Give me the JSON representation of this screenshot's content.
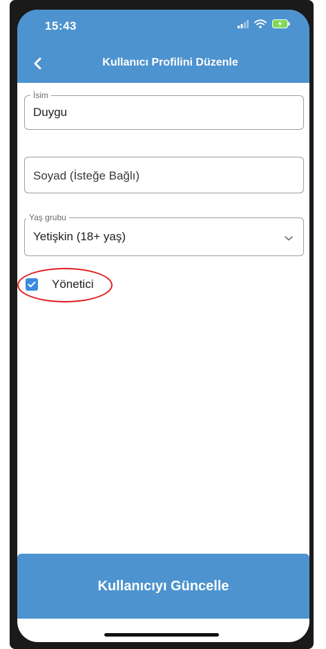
{
  "status_bar": {
    "time": "15:43"
  },
  "header": {
    "title": "Kullanıcı Profilini Düzenle"
  },
  "form": {
    "first_name": {
      "label": "İsim",
      "value": "Duygu"
    },
    "last_name": {
      "placeholder": "Soyad (İsteğe Bağlı)"
    },
    "age_group": {
      "label": "Yaş grubu",
      "value": "Yetişkin (18+ yaş)"
    },
    "admin": {
      "label": "Yönetici",
      "checked": true
    }
  },
  "footer": {
    "update_button_label": "Kullanıcıyı Güncelle"
  },
  "colors": {
    "header_blue": "#4d93cf",
    "checkbox_blue": "#3b8be0",
    "annotation_red": "#e01b1b"
  },
  "icons": [
    "back-icon",
    "signal-icon",
    "wifi-icon",
    "battery-icon",
    "chevron-down-icon",
    "checkmark-icon"
  ]
}
